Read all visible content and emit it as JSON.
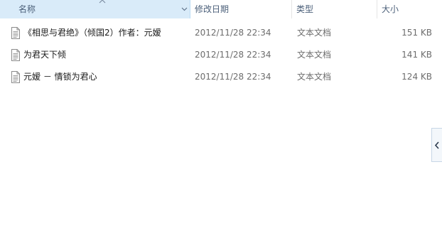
{
  "columns": {
    "name": "名称",
    "date_modified": "修改日期",
    "type": "类型",
    "size": "大小"
  },
  "files": [
    {
      "name": "《相思与君绝》（倾国2）作者：元嫒",
      "date_modified": "2012/11/28 22:34",
      "type": "文本文档",
      "size": "151 KB",
      "icon": "text-file-icon"
    },
    {
      "name": "为君天下倾",
      "date_modified": "2012/11/28 22:34",
      "type": "文本文档",
      "size": "141 KB",
      "icon": "text-file-icon"
    },
    {
      "name": "元嫒 － 情锁为君心",
      "date_modified": "2012/11/28 22:34",
      "type": "文本文档",
      "size": "124 KB",
      "icon": "text-file-icon"
    }
  ],
  "sort": {
    "column": "name",
    "direction": "ascending"
  },
  "colors": {
    "header_selected_bg": "#d9ebf9",
    "header_text": "#4c607a",
    "secondary_text": "#6d6d6d"
  }
}
